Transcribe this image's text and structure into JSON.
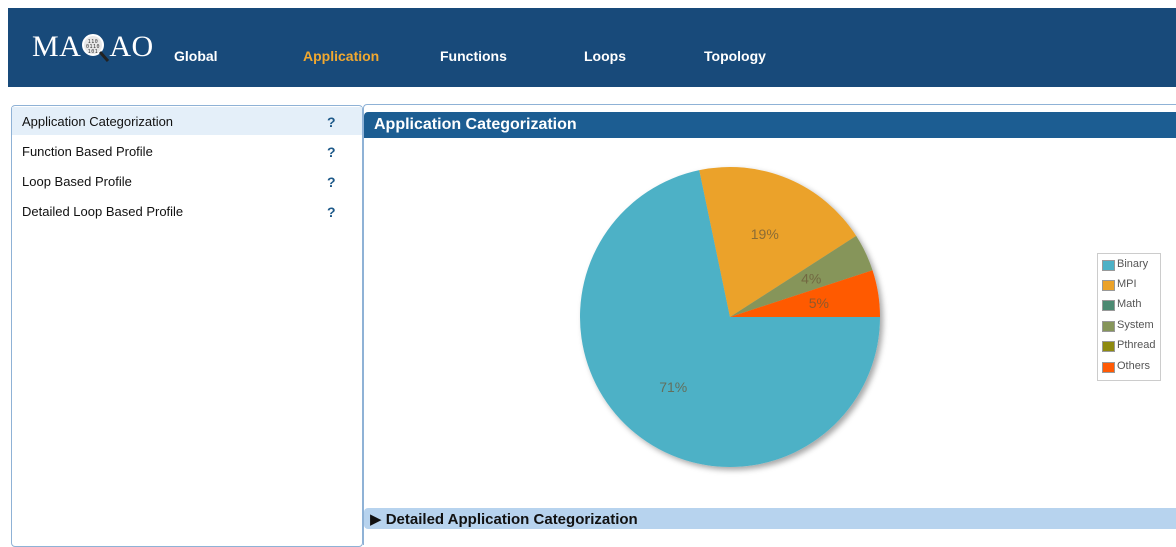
{
  "header": {
    "logo_text": "MAQAO",
    "nav": [
      {
        "label": "Global",
        "active": false
      },
      {
        "label": "Application",
        "active": true
      },
      {
        "label": "Functions",
        "active": false
      },
      {
        "label": "Loops",
        "active": false
      },
      {
        "label": "Topology",
        "active": false
      }
    ]
  },
  "sidebar": {
    "items": [
      {
        "label": "Application Categorization",
        "help": "?",
        "selected": true
      },
      {
        "label": "Function Based Profile",
        "help": "?",
        "selected": false
      },
      {
        "label": "Loop Based Profile",
        "help": "?",
        "selected": false
      },
      {
        "label": "Detailed Loop Based Profile",
        "help": "?",
        "selected": false
      }
    ]
  },
  "main": {
    "title": "Application Categorization",
    "detail_label": "Detailed Application Categorization",
    "detail_toggle_icon": "triangle-right-icon"
  },
  "colors": {
    "header_bg": "#184a7a",
    "nav_active": "#f0a830",
    "panel_header_bg": "#1c5d92",
    "detail_bar_bg": "#b7d3ee"
  },
  "chart_data": {
    "type": "pie",
    "title": "",
    "slices": [
      {
        "label": "Binary",
        "value": 71,
        "display": "71%",
        "color": "#4db1c6"
      },
      {
        "label": "MPI",
        "value": 19,
        "display": "19%",
        "color": "#eba229"
      },
      {
        "label": "Math",
        "value": 0,
        "display": "",
        "color": "#4c8a72"
      },
      {
        "label": "System",
        "value": 4,
        "display": "4%",
        "color": "#86955a"
      },
      {
        "label": "Pthread",
        "value": 0,
        "display": "",
        "color": "#8e8a10"
      },
      {
        "label": "Others",
        "value": 5,
        "display": "5%",
        "color": "#ff5a05"
      }
    ],
    "legend_placement": "right"
  }
}
